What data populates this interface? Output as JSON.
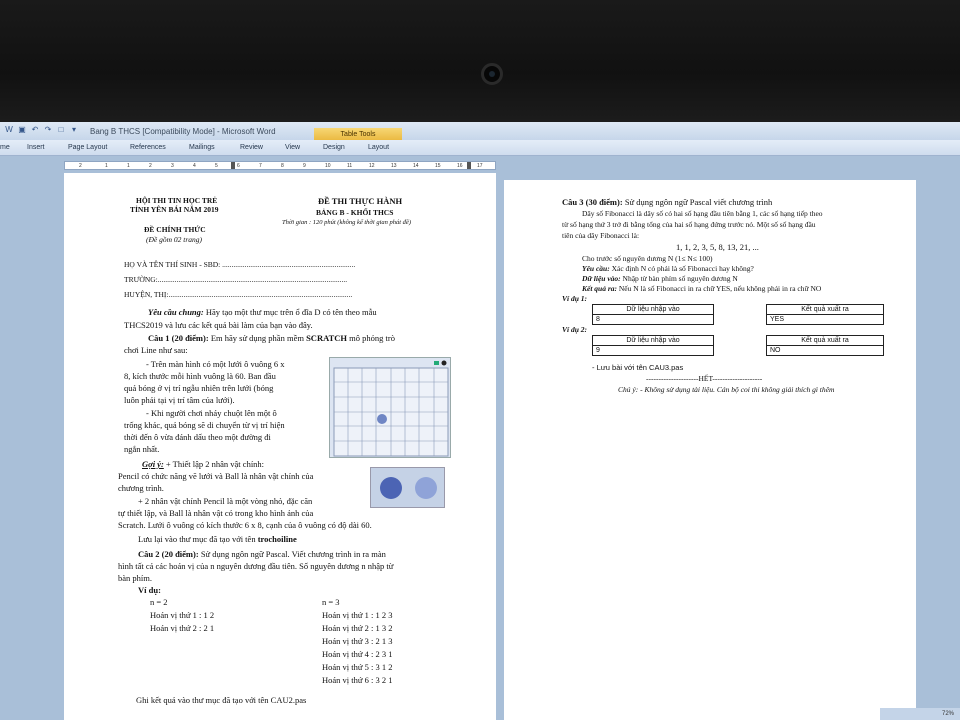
{
  "window": {
    "title": "Bang B THCS [Compatibility Mode] - Microsoft Word",
    "table_tools": "Table Tools"
  },
  "ribbon": {
    "tabs": [
      "me",
      "Insert",
      "Page Layout",
      "References",
      "Mailings",
      "Review",
      "View",
      "Design",
      "Layout"
    ]
  },
  "ruler": {
    "ticks": [
      "2",
      "1",
      "1",
      "2",
      "3",
      "4",
      "5",
      "6",
      "7",
      "8",
      "9",
      "10",
      "11",
      "12",
      "13",
      "14",
      "15",
      "16",
      "17",
      "18"
    ]
  },
  "doc_left": {
    "org1": "HỘI THI TIN HỌC TRẺ",
    "org2": "TỈNH YÊN BÁI NĂM 2019",
    "official": "ĐỀ CHÍNH THỨC",
    "pages": "(Đề gồm 02 trang)",
    "title": "ĐỀ THI THỰC HÀNH",
    "board": "BẢNG B - KHỐI THCS",
    "time": "Thời gian : 120 phút (không kể thời gian phát đề)",
    "f1": "HỌ VÀ TÊN THÍ SINH - SBD: .......................................................................",
    "f2": "TRƯỜNG:.....................................................................................................",
    "f3": "HUYỆN, THỊ:..................................................................................................",
    "req_label": "Yêu cầu chung:",
    "req1": " Hãy tạo một thư mục trên ổ đĩa D có tên theo mẫu",
    "req2": "THCS2019 và lưu các kết quả bài làm của bạn vào đây.",
    "c1_label": "Câu 1 (20 điểm):",
    "c1a": " Em hãy sử dụng phần mềm ",
    "c1b": "SCRATCH",
    "c1c": " mô phỏng trò",
    "c1d": "chơi Line như sau:",
    "l1": "- Trên màn hình có một lưới ô vuông 6 x",
    "l2": "8, kích thước mỗi hình vuông là 60. Ban đầu",
    "l3": "quả bóng ở vị trí ngẫu nhiên trên lưới (bóng",
    "l4": "luôn phải tại vị trí tâm của lưới).",
    "l5": "- Khi người chơi nháy chuột lên một ô",
    "l6": "trống khác, quả bóng sẽ di chuyển từ vị trí hiện",
    "l7": "thời đến ô vừa đánh dấu theo một đường đi",
    "l8": "ngắn nhất.",
    "g_label": "Gợi ý:",
    "g1": " + Thiết lập 2 nhân vật chính:",
    "g2": "Pencil có chức năng vẽ lưới và Ball là nhân vật chính của",
    "g3": "chương trình.",
    "g4": "+ 2 nhân vật chính Pencil là một vòng nhỏ, đặc căn",
    "g5": "tự thiết lập, và Ball là nhân vật có trong kho hình ảnh của",
    "g6": "Scratch. Lưới ô vuông có kích thước 6 x 8, cạnh của ô vuông có độ dài 60.",
    "save1a": "Lưu lại vào thư mục đã tạo với tên ",
    "save1b": "trochoiline",
    "c2_label": "Câu 2 (20 điểm):",
    "c2a": " Sử dụng ngôn ngữ Pascal. Viết chương trình in ra màn",
    "c2b": "hình tất cả các hoán vị của n nguyên dương đầu tiên. Số nguyên dương n nhập từ",
    "c2c": "bàn phím.",
    "vd": "Ví dụ:",
    "n2": "n = 2",
    "hv1": "Hoán vị thứ 1 :  1   2",
    "hv2": "Hoán vị thứ 2 :  2   1",
    "n3": "n = 3",
    "r1": "Hoán vị thứ 1 :  1   2   3",
    "r2": "Hoán vị thứ 2 :  1   3   2",
    "r3": "Hoán vị thứ 3 :  2   1   3",
    "r4": "Hoán vị thứ 4 :  2   3   1",
    "r5": "Hoán vị thứ 5 :  3   1   2",
    "r6": "Hoán vị thứ 6 :  3   2   1",
    "save2": "Ghi kết quả vào thư mục đã tạo với tên CAU2.pas"
  },
  "doc_right": {
    "c3_label": "Câu 3 (30 điểm):",
    "c3a": " Sử dụng ngôn ngữ Pascal viết chương trình",
    "d1": "Dãy số Fibonacci là dãy số có hai số hạng đầu tiên bằng 1, các số hạng tiếp theo",
    "d2": "từ số hạng thứ 3 trở đi bằng tổng của hai số hạng đứng trước nó. Một số số hạng đầu",
    "d3": "tiên của dãy Fibonacci là:",
    "seq": "1, 1, 2, 3, 5, 8, 13, 21, ...",
    "d4": "Cho trước số nguyên dương N (1≤ N≤ 100)",
    "yc_label": "Yêu cầu:",
    "yc": " Xác định N có phải là số Fibonacci hay không?",
    "in_label": "Dữ liệu vào:",
    "in": " Nhập từ bàn phím số nguyên dương N",
    "out_label": "Kết quả ra:",
    "out": " Nếu N là số Fibonacci in ra chữ YES, nếu không phải in ra chữ NO",
    "ex1": "Ví dụ 1:",
    "ex2": "Ví dụ 2:",
    "in_header": "Dữ liệu nhập vào",
    "out_header": "Kết quả xuất ra",
    "ex1_in": "8",
    "ex1_out": "YES",
    "ex2_in": "9",
    "ex2_out": "NO",
    "save3": "- Lưu bài với tên CAU3.pas",
    "end": "---------------------HẾT--------------------",
    "note": "Chú ý: - Không sử dụng tài liệu. Cán bộ coi thi không giải thích gì thêm"
  },
  "status": {
    "zoom": "72%"
  }
}
